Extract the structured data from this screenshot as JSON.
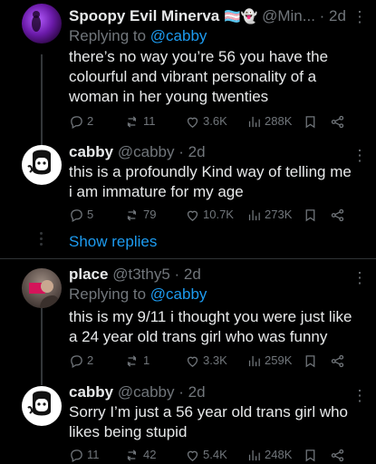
{
  "tweets": [
    {
      "name": "Spoopy Evil Minerva",
      "name_suffix": "🏳️‍⚧️👻",
      "handle": "@Min...",
      "time": "· 2d",
      "replying_label": "Replying to",
      "replying_mention": "@cabby",
      "lines": [
        "there’s no way you’re 56 you have the",
        "colourful and vibrant personality of a",
        "woman in her young twenties"
      ],
      "replies": "2",
      "retweets": "11",
      "likes": "3.6K",
      "views": "288K"
    },
    {
      "name": "cabby",
      "handle": "@cabby",
      "time": "· 2d",
      "lines": [
        "this is a profoundly Kind way of telling me",
        "i am immature for my age"
      ],
      "replies": "5",
      "retweets": "79",
      "likes": "10.7K",
      "views": "273K"
    },
    {
      "name": "place",
      "handle": "@t3thy5",
      "time": "· 2d",
      "replying_label": "Replying to",
      "replying_mention": "@cabby",
      "lines": [
        "this is my 9/11 i thought you were just like",
        "a 24 year old trans girl who was funny"
      ],
      "replies": "2",
      "retweets": "1",
      "likes": "3.3K",
      "views": "259K"
    },
    {
      "name": "cabby",
      "handle": "@cabby",
      "time": "· 2d",
      "lines": [
        "Sorry I’m just a 56 year old trans girl who",
        "likes being stupid"
      ],
      "replies": "11",
      "retweets": "42",
      "likes": "5.4K",
      "views": "248K"
    }
  ],
  "show_replies": "Show replies"
}
